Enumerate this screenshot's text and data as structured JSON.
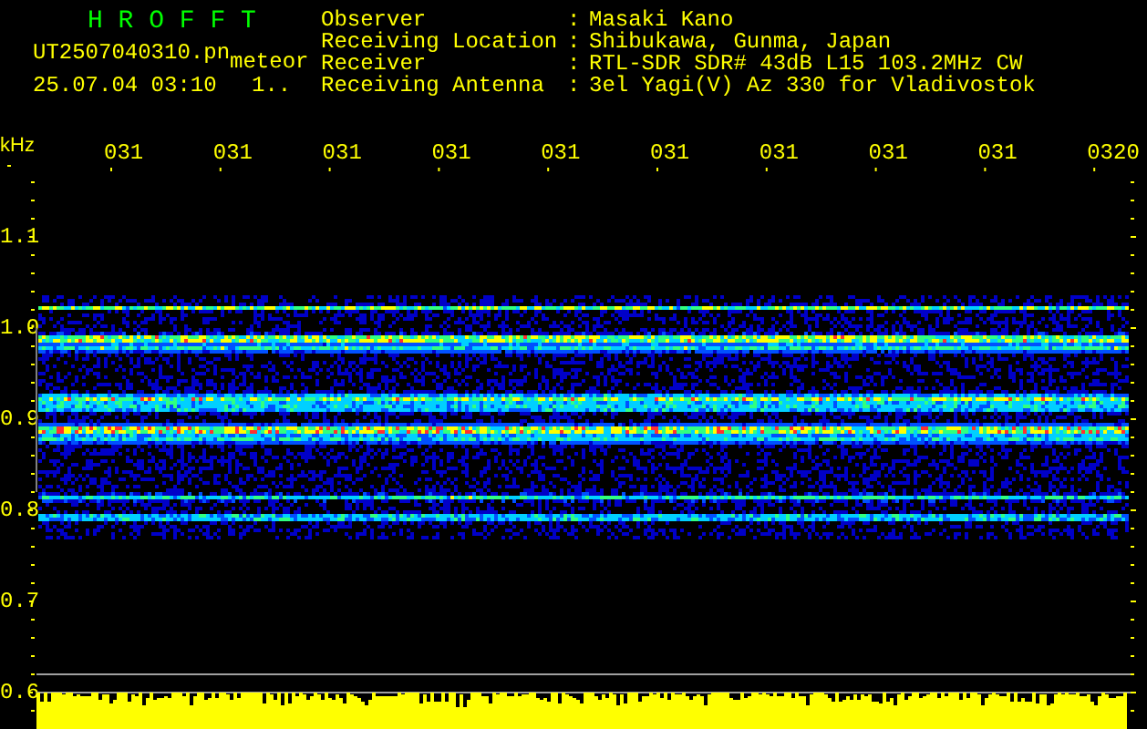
{
  "title": "H R O F F T",
  "file_name": "UT2507040310.pn",
  "mode": "meteor",
  "timestamp": "25.07.04 03:10",
  "counter": "1..",
  "info": [
    {
      "label": "Observer",
      "separator": ":",
      "value": "Masaki Kano"
    },
    {
      "label": "Receiving Location",
      "separator": ":",
      "value": "Shibukawa, Gunma, Japan"
    },
    {
      "label": "Receiver",
      "separator": ":",
      "value": "RTL-SDR SDR# 43dB L15 103.2MHz CW"
    },
    {
      "label": "Receiving Antenna",
      "separator": ":",
      "value": "3el Yagi(V) Az 330 for Vladivostok"
    }
  ],
  "y_unit": "kHz",
  "time_labels": [
    "031",
    "031",
    "031",
    "031",
    "031",
    "031",
    "031",
    "031",
    "031",
    "0320"
  ],
  "y_labels": [
    "1.1",
    "1.0",
    "0.9",
    "0.8",
    "0.7",
    "0.6"
  ]
}
